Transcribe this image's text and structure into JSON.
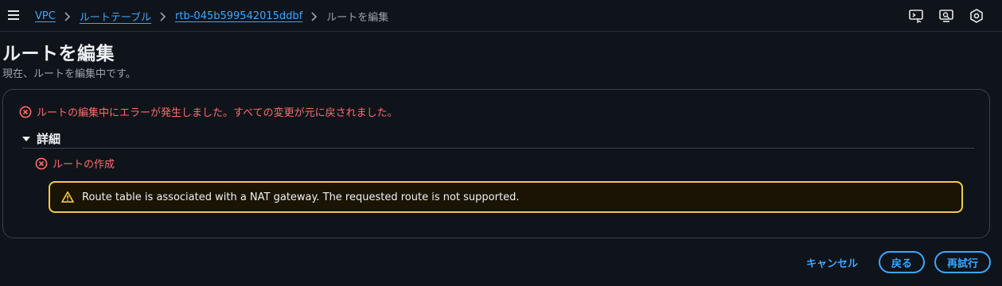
{
  "breadcrumb": {
    "items": [
      "VPC",
      "ルートテーブル",
      "rtb-045b599542015ddbf"
    ],
    "current": "ルートを編集"
  },
  "header": {
    "title": "ルートを編集",
    "subtitle": "現在、ルートを編集中です。"
  },
  "error": {
    "message": "ルートの編集中にエラーが発生しました。すべての変更が元に戻されました。",
    "details_label": "詳細",
    "sub_error": "ルートの作成",
    "warning": "Route table is associated with a NAT gateway. The requested route is not supported."
  },
  "footer": {
    "cancel_label": "キャンセル",
    "back_label": "戻る",
    "retry_label": "再試行"
  },
  "icons": {
    "menu": "hamburger-menu-icon",
    "top_right": [
      "cloudshell-icon",
      "feedback-icon",
      "settings-icon"
    ],
    "error": "error-circle-icon",
    "warning": "warning-triangle-icon",
    "expand": "caret-down-icon"
  },
  "colors": {
    "background": "#0f141a",
    "link": "#3ea6ff",
    "error": "#ff6b6b",
    "warning_border": "#f2c94c"
  }
}
